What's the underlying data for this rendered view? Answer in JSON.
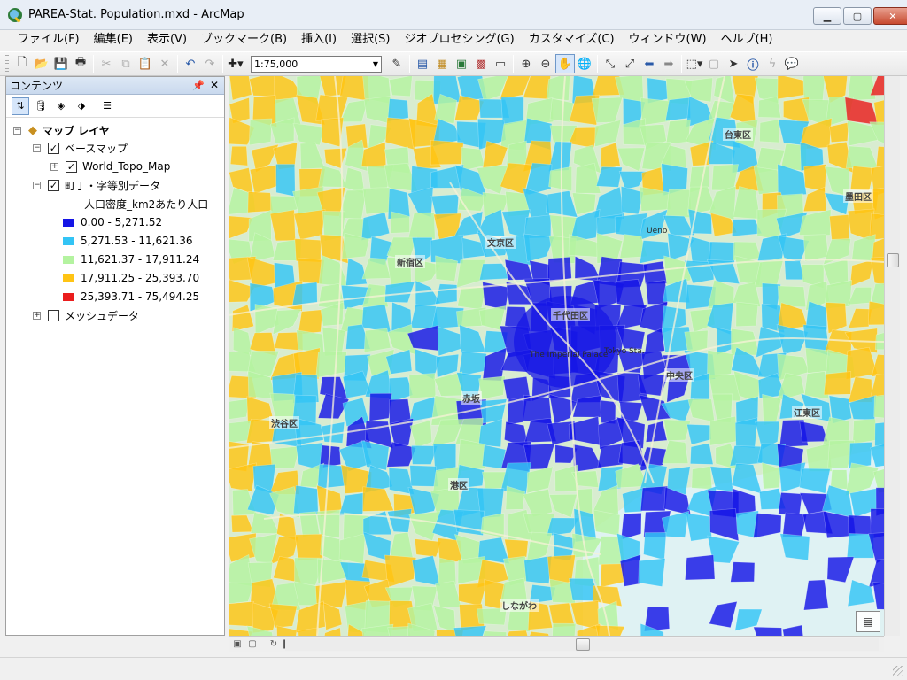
{
  "window": {
    "title": "PAREA-Stat. Population.mxd - ArcMap",
    "minimize_icon": "minimize-icon",
    "maximize_icon": "maximize-icon",
    "close_icon": "close-icon"
  },
  "menu": [
    "ファイル(F)",
    "編集(E)",
    "表示(V)",
    "ブックマーク(B)",
    "挿入(I)",
    "選択(S)",
    "ジオプロセシング(G)",
    "カスタマイズ(C)",
    "ウィンドウ(W)",
    "ヘルプ(H)"
  ],
  "toolbar": {
    "scale_value": "1:75,000"
  },
  "toc": {
    "title": "コンテンツ",
    "root_label": "マップ レイヤ",
    "basemap_group": "ベースマップ",
    "basemap_layer": "World_Topo_Map",
    "data_layer": "町丁・字等別データ",
    "field_label": "人口密度_km2あたり人口",
    "legend": [
      {
        "label": "0.00 - 5,271.52",
        "color": "#1515e6"
      },
      {
        "label": "5,271.53 - 11,621.36",
        "color": "#33c4f5"
      },
      {
        "label": "11,621.37 - 17,911.24",
        "color": "#b4f3a0"
      },
      {
        "label": "17,911.25 - 25,393.70",
        "color": "#ffc414"
      },
      {
        "label": "25,393.71 - 75,494.25",
        "color": "#ea1d1d"
      }
    ],
    "mesh_layer": "メッシュデータ"
  },
  "map": {
    "labels": {
      "bunkyo": "文京区",
      "taito": "台東区",
      "shinjuku": "新宿区",
      "chiyoda": "千代田区",
      "chuo": "中央区",
      "koto": "江東区",
      "minato": "港区",
      "shibuya": "渋谷区",
      "sumida": "墨田区",
      "tokyo_sta": "Tokyo Sta.",
      "imperial": "The Imperial Palace",
      "ueno": "Ueno",
      "akasaka": "赤坂",
      "shinagawa": "しながわ"
    }
  }
}
